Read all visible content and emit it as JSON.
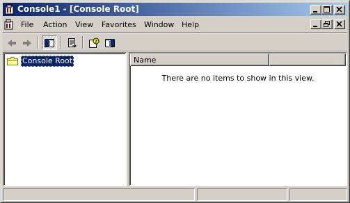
{
  "window": {
    "title": "Console1 - [Console Root]"
  },
  "menubar": {
    "items": [
      "File",
      "Action",
      "View",
      "Favorites",
      "Window",
      "Help"
    ]
  },
  "toolbar": {
    "buttons": [
      "back-icon",
      "forward-icon",
      "show-hide-tree-icon",
      "export-list-icon",
      "help-icon",
      "show-hide-action-pane-icon"
    ]
  },
  "tree": {
    "root_label": "Console Root"
  },
  "list": {
    "columns": [
      "Name",
      ""
    ],
    "empty_message": "There are no items to show in this view."
  },
  "colors": {
    "title_active": "#0a246a",
    "face": "#d4d0c8",
    "selection": "#0a246a"
  }
}
